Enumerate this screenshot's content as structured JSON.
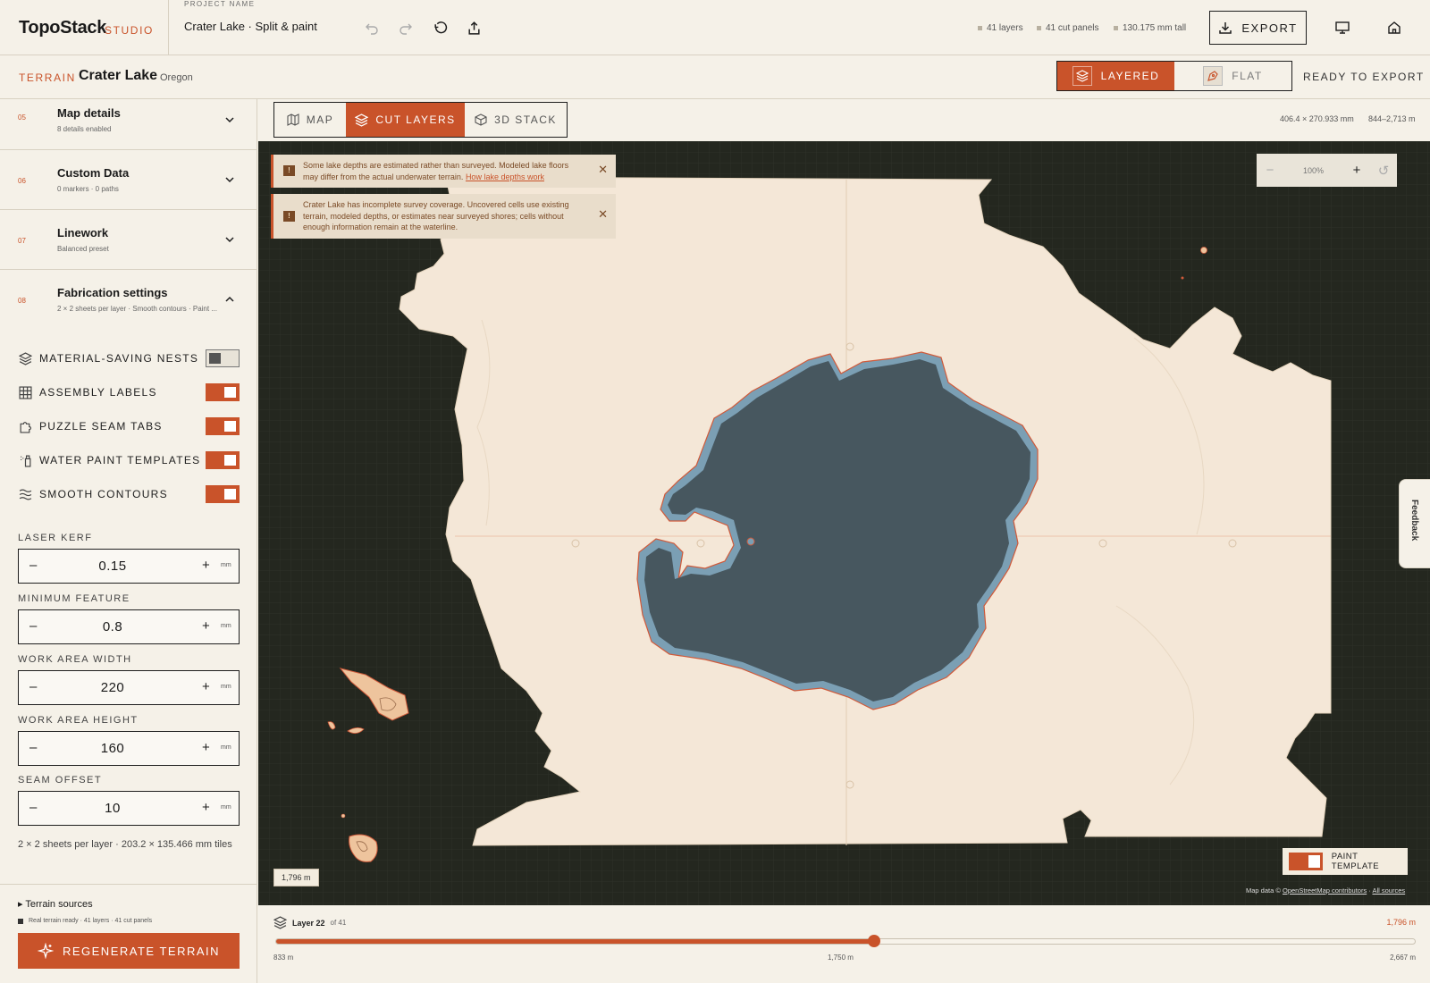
{
  "app": {
    "brand": "TopoStack",
    "brand_sub": "STUDIO"
  },
  "project": {
    "label": "PROJECT NAME",
    "name": "Crater Lake · Split & paint"
  },
  "toolbar": {
    "undo_icon": "undo-icon",
    "redo_icon": "redo-icon",
    "reset_icon": "reset-icon",
    "share_icon": "share-icon"
  },
  "stats": {
    "layers": "41 layers",
    "panels": "41 cut panels",
    "height": "130.175 mm tall"
  },
  "export_label": "EXPORT",
  "terrain": {
    "tag": "TERRAIN",
    "title": "Crater Lake",
    "region": "Oregon"
  },
  "modes": {
    "layered": "LAYERED",
    "flat": "FLAT",
    "status": "READY TO EXPORT"
  },
  "sections": [
    {
      "num": "05",
      "title": "Map details",
      "sub": "8 details enabled"
    },
    {
      "num": "06",
      "title": "Custom Data",
      "sub": "0 markers · 0 paths"
    },
    {
      "num": "07",
      "title": "Linework",
      "sub": "Balanced preset"
    },
    {
      "num": "08",
      "title": "Fabrication settings",
      "sub": "2 × 2 sheets per layer · Smooth contours · Paint ..."
    }
  ],
  "toggles": [
    {
      "label": "MATERIAL-SAVING NESTS",
      "on": false
    },
    {
      "label": "ASSEMBLY LABELS",
      "on": true
    },
    {
      "label": "PUZZLE SEAM TABS",
      "on": true
    },
    {
      "label": "WATER PAINT TEMPLATES",
      "on": true
    },
    {
      "label": "SMOOTH CONTOURS",
      "on": true
    }
  ],
  "fields": [
    {
      "label": "LASER KERF",
      "value": "0.15",
      "unit": "mm"
    },
    {
      "label": "MINIMUM FEATURE",
      "value": "0.8",
      "unit": "mm"
    },
    {
      "label": "WORK AREA WIDTH",
      "value": "220",
      "unit": "mm"
    },
    {
      "label": "WORK AREA HEIGHT",
      "value": "160",
      "unit": "mm"
    },
    {
      "label": "SEAM OFFSET",
      "value": "10",
      "unit": "mm"
    }
  ],
  "sheet_note": "2 × 2 sheets per layer · 203.2 × 135.466 mm tiles",
  "sources": {
    "title": "Terrain sources",
    "status": "Real terrain ready · 41 layers · 41 cut panels",
    "regenerate": "REGENERATE TERRAIN"
  },
  "view_tabs": {
    "map": "MAP",
    "cut": "CUT LAYERS",
    "stack": "3D STACK"
  },
  "dims": {
    "size": "406.4 × 270.933 mm",
    "range": "844–2,713 m"
  },
  "alerts": [
    {
      "text": "Some lake depths are estimated rather than surveyed. Modeled lake floors may differ from the actual underwater terrain.",
      "link": "How lake depths work"
    },
    {
      "text": "Crater Lake has incomplete survey coverage. Uncovered cells use existing terrain, modeled depths, or estimates near surveyed shores; cells without enough information remain at the waterline.",
      "link": ""
    }
  ],
  "zoom": {
    "value": "100%"
  },
  "scale_chip": "1,796 m",
  "paint_template": "PAINT TEMPLATE",
  "attribution": {
    "prefix": "Map data ©",
    "osm": "OpenStreetMap contributors",
    "sep": "·",
    "all": "All sources"
  },
  "feedback": "Feedback",
  "layer": {
    "label": "Layer 22",
    "of": "of 41",
    "elevation": "1,796 m",
    "fraction": 0.525,
    "ticks": [
      "833 m",
      "1,750 m",
      "2,667 m"
    ]
  },
  "colors": {
    "accent": "#c9532a",
    "canvas": "#24271f",
    "paper": "#f4e7d7",
    "water": "#47575f"
  }
}
